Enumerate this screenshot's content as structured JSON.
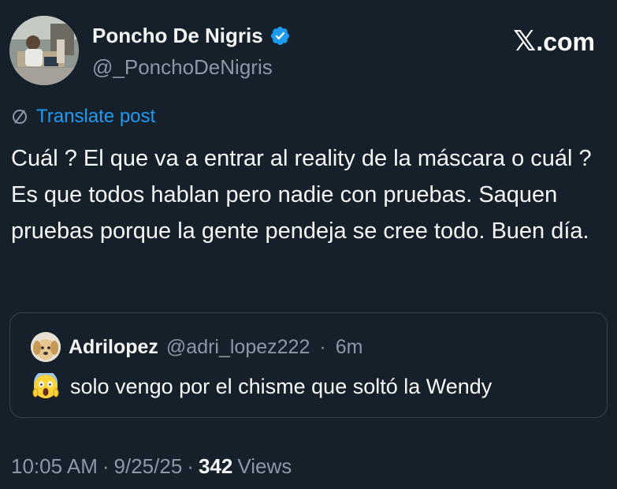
{
  "author": {
    "display_name": "Poncho De Nigris",
    "handle": "@_PonchoDeNigris",
    "verified": true,
    "verified_color": "#1d9bf0"
  },
  "brand": {
    "x": "𝕏",
    "suffix": ".com"
  },
  "translate": {
    "label": "Translate post",
    "icon": "globe-slash-icon",
    "color": "#1d9bf0"
  },
  "post": {
    "text": "Cuál ? El que va a entrar al reality de la máscara o cuál ? Es que todos hablan pero nadie con pruebas. Saquen pruebas porque la gente pendeja se cree todo.  Buen día."
  },
  "quote": {
    "display_name": "Adrilopez",
    "handle": "@adri_lopez222",
    "separator": "·",
    "time": "6m",
    "emoji_icon": "face-screaming-in-fear-icon",
    "text": "solo vengo por el chisme que soltó la Wendy"
  },
  "meta": {
    "time": "10:05 AM",
    "sep1": "·",
    "date": "9/25/25",
    "sep2": "·",
    "views_count": "342",
    "views_label": "Views"
  },
  "colors": {
    "background": "#15202b",
    "text": "#f7f9f9",
    "secondary": "#8b98a5",
    "border": "#38444d",
    "accent": "#1d9bf0"
  }
}
